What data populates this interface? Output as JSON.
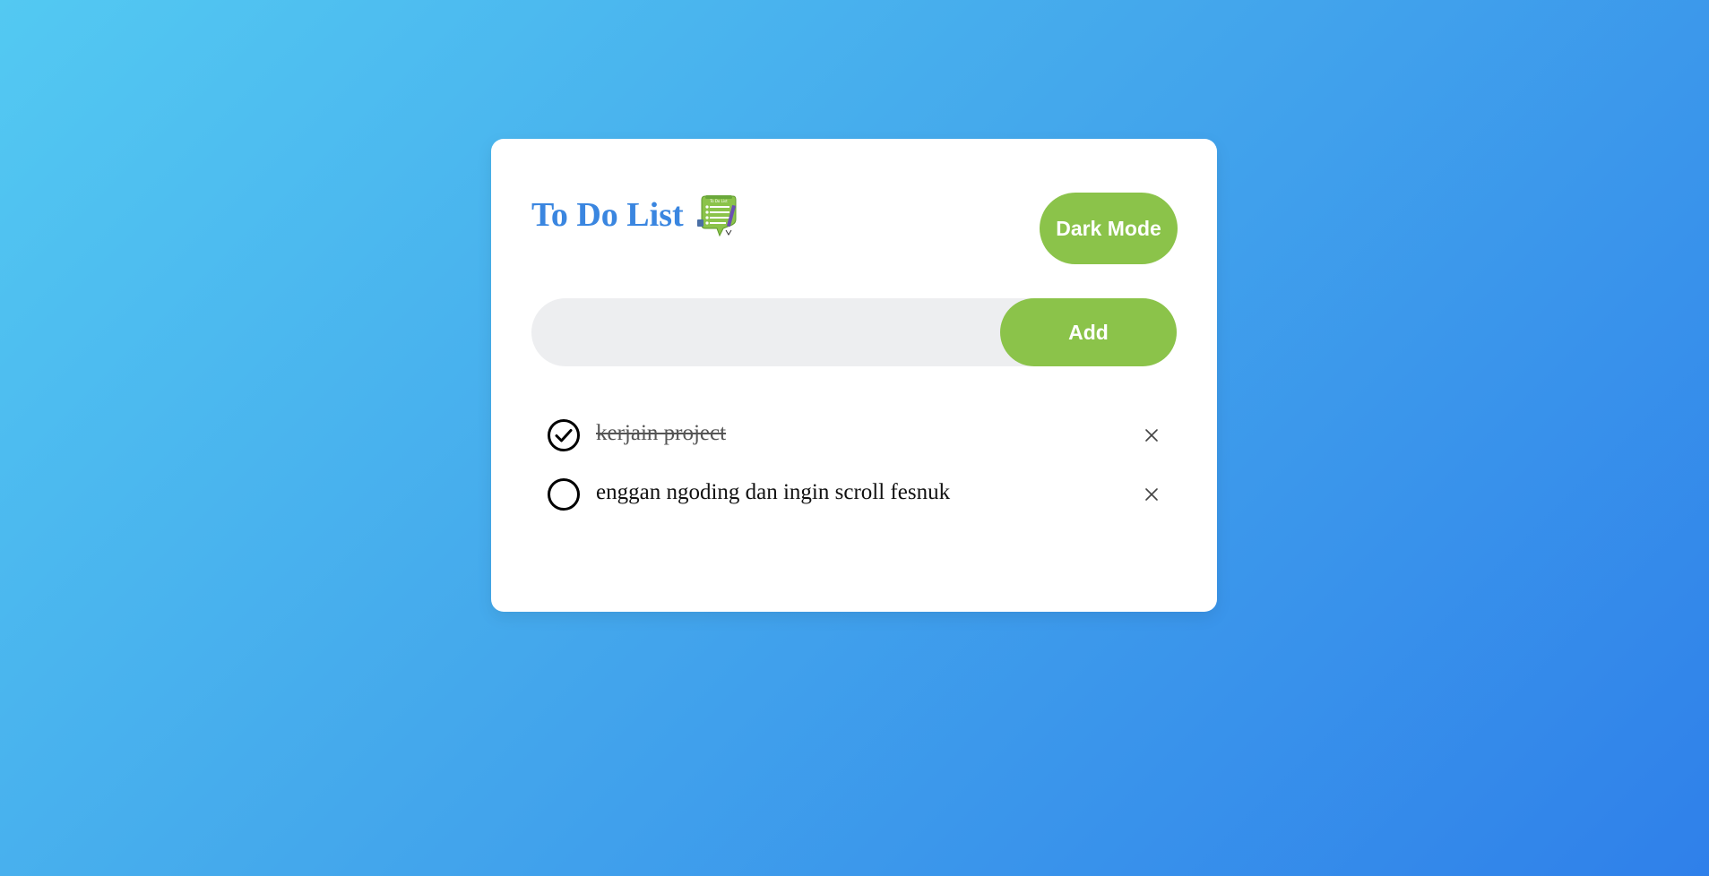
{
  "app": {
    "title": "To Do List",
    "title_icon": "notepad-icon"
  },
  "toolbar": {
    "dark_mode_label": "Dark Mode"
  },
  "new_task": {
    "value": "",
    "placeholder": "",
    "add_label": "Add"
  },
  "tasks": [
    {
      "text": "kerjain project",
      "checked": true,
      "check_icon": "checked-circle-icon",
      "delete_icon": "close-icon"
    },
    {
      "text": "enggan ngoding dan ingin scroll fesnuk",
      "checked": false,
      "check_icon": "unchecked-circle-icon",
      "delete_icon": "close-icon"
    }
  ],
  "colors": {
    "accent": "#8bc34a",
    "title": "#3a86e0",
    "input_bg": "#edeef0",
    "card_bg": "#ffffff",
    "gradient_start": "#53c9f2",
    "gradient_end": "#2f80ea"
  }
}
